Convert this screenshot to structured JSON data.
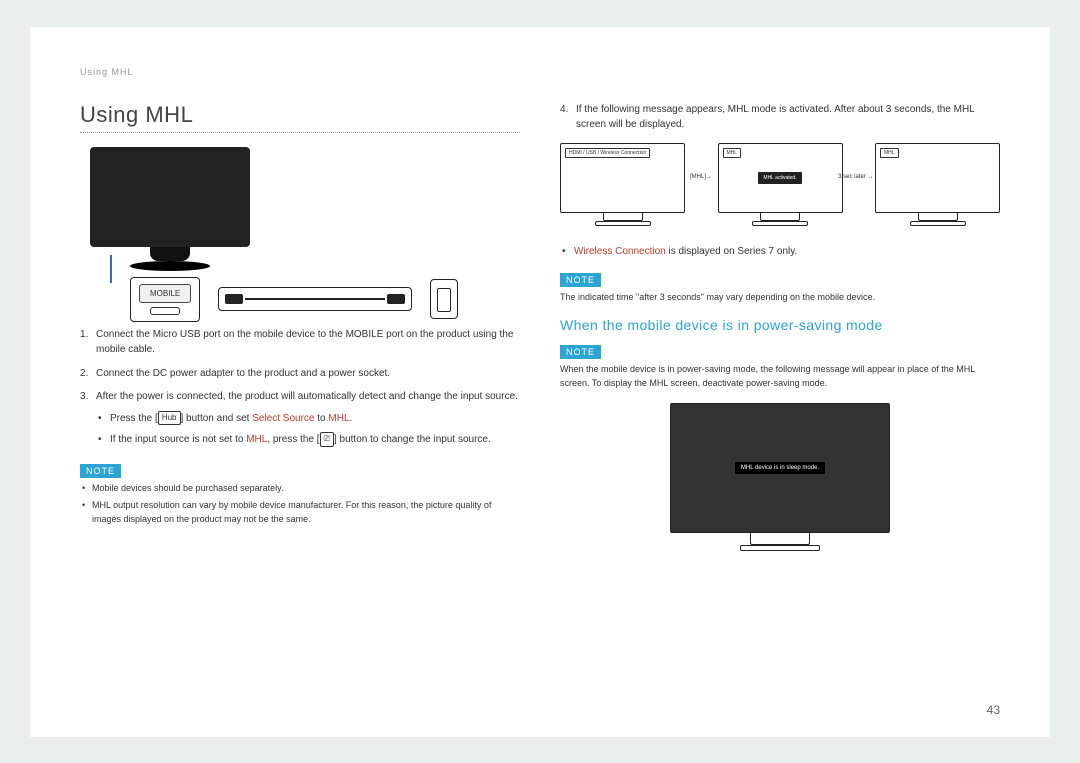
{
  "header_path": "Using MHL",
  "page_number": "43",
  "left": {
    "title": "Using MHL",
    "port_label": "MOBILE",
    "step1": "Connect the Micro USB port on the mobile device to the MOBILE port on the product using the mobile cable.",
    "step2": "Connect the DC power adapter to the product and a power socket.",
    "step3": "After the power is connected, the product will automatically detect and change the input source.",
    "sub1_pre": "Press the [",
    "sub1_btn": "Hub",
    "sub1_mid": "] button and set ",
    "sub1_red1": "Select Source",
    "sub1_to": " to ",
    "sub1_red2": "MHL",
    "sub1_end": ".",
    "sub2_pre": "If the input source is not set to ",
    "sub2_red": "MHL",
    "sub2_mid": ", press the [",
    "sub2_icon": "⎚",
    "sub2_end": "] button to change the input source.",
    "note_label": "NOTE",
    "note_b1": "Mobile devices should be purchased separately.",
    "note_b2": "MHL output resolution can vary by mobile device manufacturer. For this reason, the picture quality of images displayed on the product may not be the same."
  },
  "right": {
    "step4": "If the following message appears, MHL mode is activated. After about 3 seconds, the MHL screen will be displayed.",
    "mon1_label": "HDMI / USB / Wireless Connection",
    "mon1_arrow": "[MHL]→",
    "mon2_label": "MHL",
    "mon2_msg": "MHL activated.",
    "mon2_arrow": "3 sec later →",
    "mon3_label": "MHL",
    "wireless_red": "Wireless Connection",
    "wireless_rest": " is displayed on Series 7 only.",
    "note_label": "NOTE",
    "note1_text": "The indicated time \"after 3 seconds\" may vary depending on the mobile device.",
    "subtitle": "When the mobile device is in power-saving mode",
    "note2_text": "When the mobile device is in power-saving mode, the following message will appear in place of the MHL screen. To display the MHL screen, deactivate power-saving mode.",
    "sleep_msg": "MHL device is in sleep mode."
  }
}
